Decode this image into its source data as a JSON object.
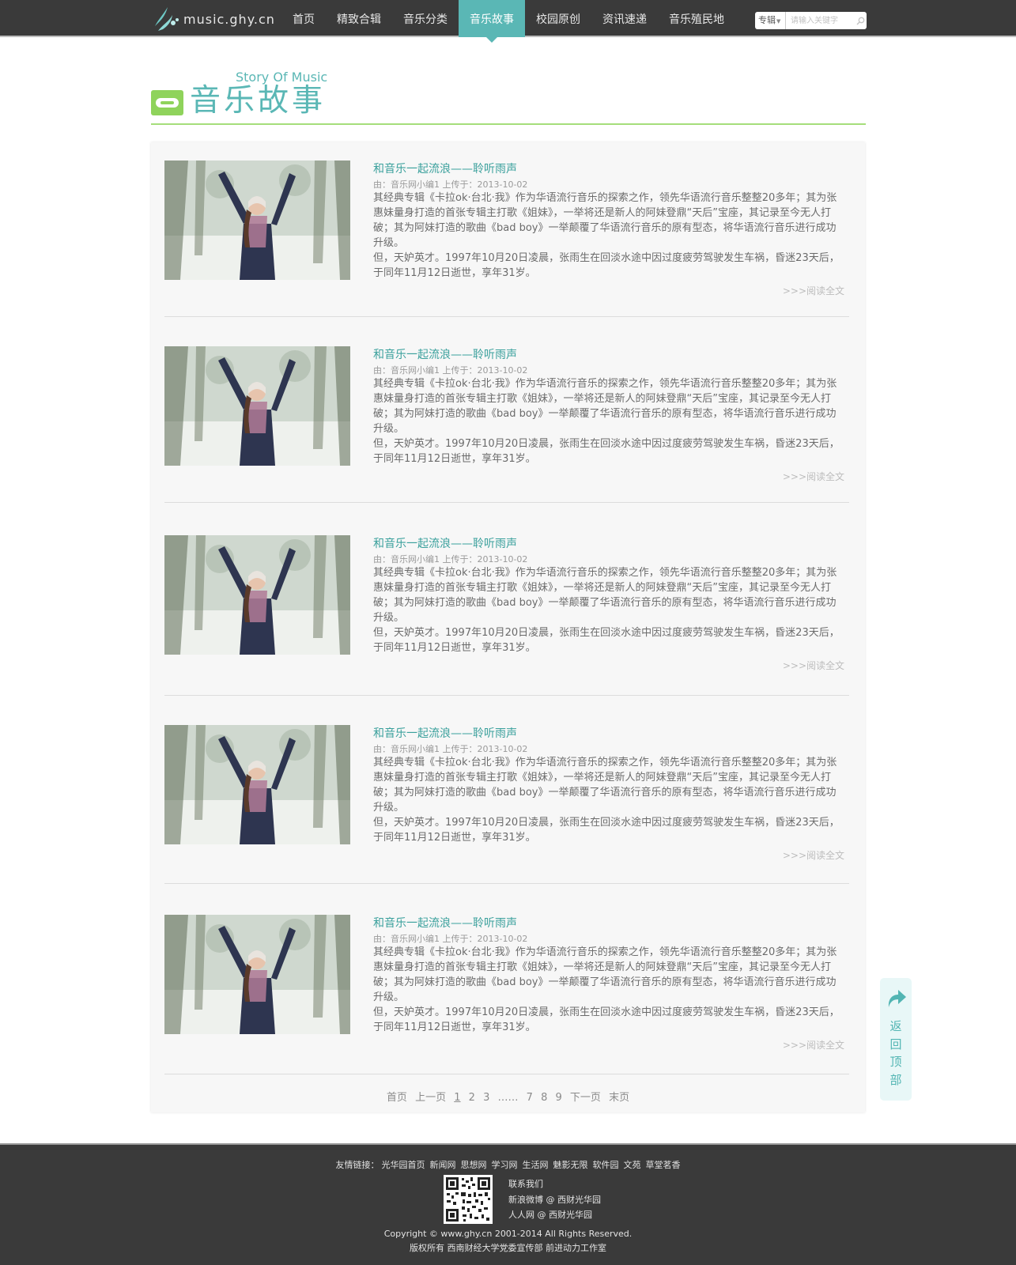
{
  "brand": {
    "logo_text": "music.ghy.cn"
  },
  "nav": {
    "items": [
      {
        "label": "首页"
      },
      {
        "label": "精致合辑"
      },
      {
        "label": "音乐分类"
      },
      {
        "label": "音乐故事",
        "active": true
      },
      {
        "label": "校园原创"
      },
      {
        "label": "资讯速递"
      },
      {
        "label": "音乐殖民地"
      }
    ]
  },
  "search": {
    "type_label": "专辑",
    "placeholder": "请输入关键字"
  },
  "header": {
    "title_en": "Story Of Music",
    "title_cn": "音乐故事"
  },
  "articles": [
    {
      "title": "和音乐一起流浪——聆听雨声",
      "meta": "由：音乐网小编1  上传于：2013-10-02",
      "p1": "其经典专辑《卡拉ok·台北·我》作为华语流行音乐的探索之作，领先华语流行音乐整整20多年；其为张惠妹量身打造的首张专辑主打歌《姐妹》，一举将还是新人的阿妹登鼎“天后”宝座，其记录至今无人打破；其为阿妹打造的歌曲《bad boy》一举颠覆了华语流行音乐的原有型态，将华语流行音乐进行成功升级。",
      "p2": "但，天妒英才。1997年10月20日凌晨，张雨生在回淡水途中因过度疲劳驾驶发生车祸，昏迷23天后，于同年11月12日逝世，享年31岁。",
      "more": ">>>阅读全文"
    },
    {
      "title": "和音乐一起流浪——聆听雨声",
      "meta": "由：音乐网小编1  上传于：2013-10-02",
      "p1": "其经典专辑《卡拉ok·台北·我》作为华语流行音乐的探索之作，领先华语流行音乐整整20多年；其为张惠妹量身打造的首张专辑主打歌《姐妹》，一举将还是新人的阿妹登鼎“天后”宝座，其记录至今无人打破；其为阿妹打造的歌曲《bad boy》一举颠覆了华语流行音乐的原有型态，将华语流行音乐进行成功升级。",
      "p2": "但，天妒英才。1997年10月20日凌晨，张雨生在回淡水途中因过度疲劳驾驶发生车祸，昏迷23天后，于同年11月12日逝世，享年31岁。",
      "more": ">>>阅读全文"
    },
    {
      "title": "和音乐一起流浪——聆听雨声",
      "meta": "由：音乐网小编1  上传于：2013-10-02",
      "p1": "其经典专辑《卡拉ok·台北·我》作为华语流行音乐的探索之作，领先华语流行音乐整整20多年；其为张惠妹量身打造的首张专辑主打歌《姐妹》，一举将还是新人的阿妹登鼎“天后”宝座，其记录至今无人打破；其为阿妹打造的歌曲《bad boy》一举颠覆了华语流行音乐的原有型态，将华语流行音乐进行成功升级。",
      "p2": "但，天妒英才。1997年10月20日凌晨，张雨生在回淡水途中因过度疲劳驾驶发生车祸，昏迷23天后，于同年11月12日逝世，享年31岁。",
      "more": ">>>阅读全文"
    },
    {
      "title": "和音乐一起流浪——聆听雨声",
      "meta": "由：音乐网小编1  上传于：2013-10-02",
      "p1": "其经典专辑《卡拉ok·台北·我》作为华语流行音乐的探索之作，领先华语流行音乐整整20多年；其为张惠妹量身打造的首张专辑主打歌《姐妹》，一举将还是新人的阿妹登鼎“天后”宝座，其记录至今无人打破；其为阿妹打造的歌曲《bad boy》一举颠覆了华语流行音乐的原有型态，将华语流行音乐进行成功升级。",
      "p2": "但，天妒英才。1997年10月20日凌晨，张雨生在回淡水途中因过度疲劳驾驶发生车祸，昏迷23天后，于同年11月12日逝世，享年31岁。",
      "more": ">>>阅读全文"
    },
    {
      "title": "和音乐一起流浪——聆听雨声",
      "meta": "由：音乐网小编1  上传于：2013-10-02",
      "p1": "其经典专辑《卡拉ok·台北·我》作为华语流行音乐的探索之作，领先华语流行音乐整整20多年；其为张惠妹量身打造的首张专辑主打歌《姐妹》，一举将还是新人的阿妹登鼎“天后”宝座，其记录至今无人打破；其为阿妹打造的歌曲《bad boy》一举颠覆了华语流行音乐的原有型态，将华语流行音乐进行成功升级。",
      "p2": "但，天妒英才。1997年10月20日凌晨，张雨生在回淡水途中因过度疲劳驾驶发生车祸，昏迷23天后，于同年11月12日逝世，享年31岁。",
      "more": ">>>阅读全文"
    }
  ],
  "pager": {
    "first": "首页",
    "prev": "上一页",
    "pages_a": [
      "1",
      "2",
      "3"
    ],
    "ellipsis": "……",
    "pages_b": [
      "7",
      "8",
      "9"
    ],
    "next": "下一页",
    "last": "末页",
    "current": "1"
  },
  "back_to_top": {
    "chars": [
      "返",
      "回",
      "顶",
      "部"
    ]
  },
  "footer": {
    "links_label": "友情链接：",
    "links": [
      "光华园首页",
      "新闻网",
      "思想网",
      "学习网",
      "生活网",
      "魅影无限",
      "软件园",
      "文苑",
      "草堂茗香"
    ],
    "contact": [
      "联系我们",
      "新浪微博 @ 西财光华园",
      "人人网 @ 西财光华园"
    ],
    "copyright": "Copyright © www.ghy.cn 2001-2014  All Rights Reserved.",
    "owner": "版权所有 西南财经大学党委宣传部 前进动力工作室"
  },
  "colors": {
    "accent": "#5ab7b5",
    "green": "#8fd35b",
    "nav_bg": "#3a3a3a"
  }
}
